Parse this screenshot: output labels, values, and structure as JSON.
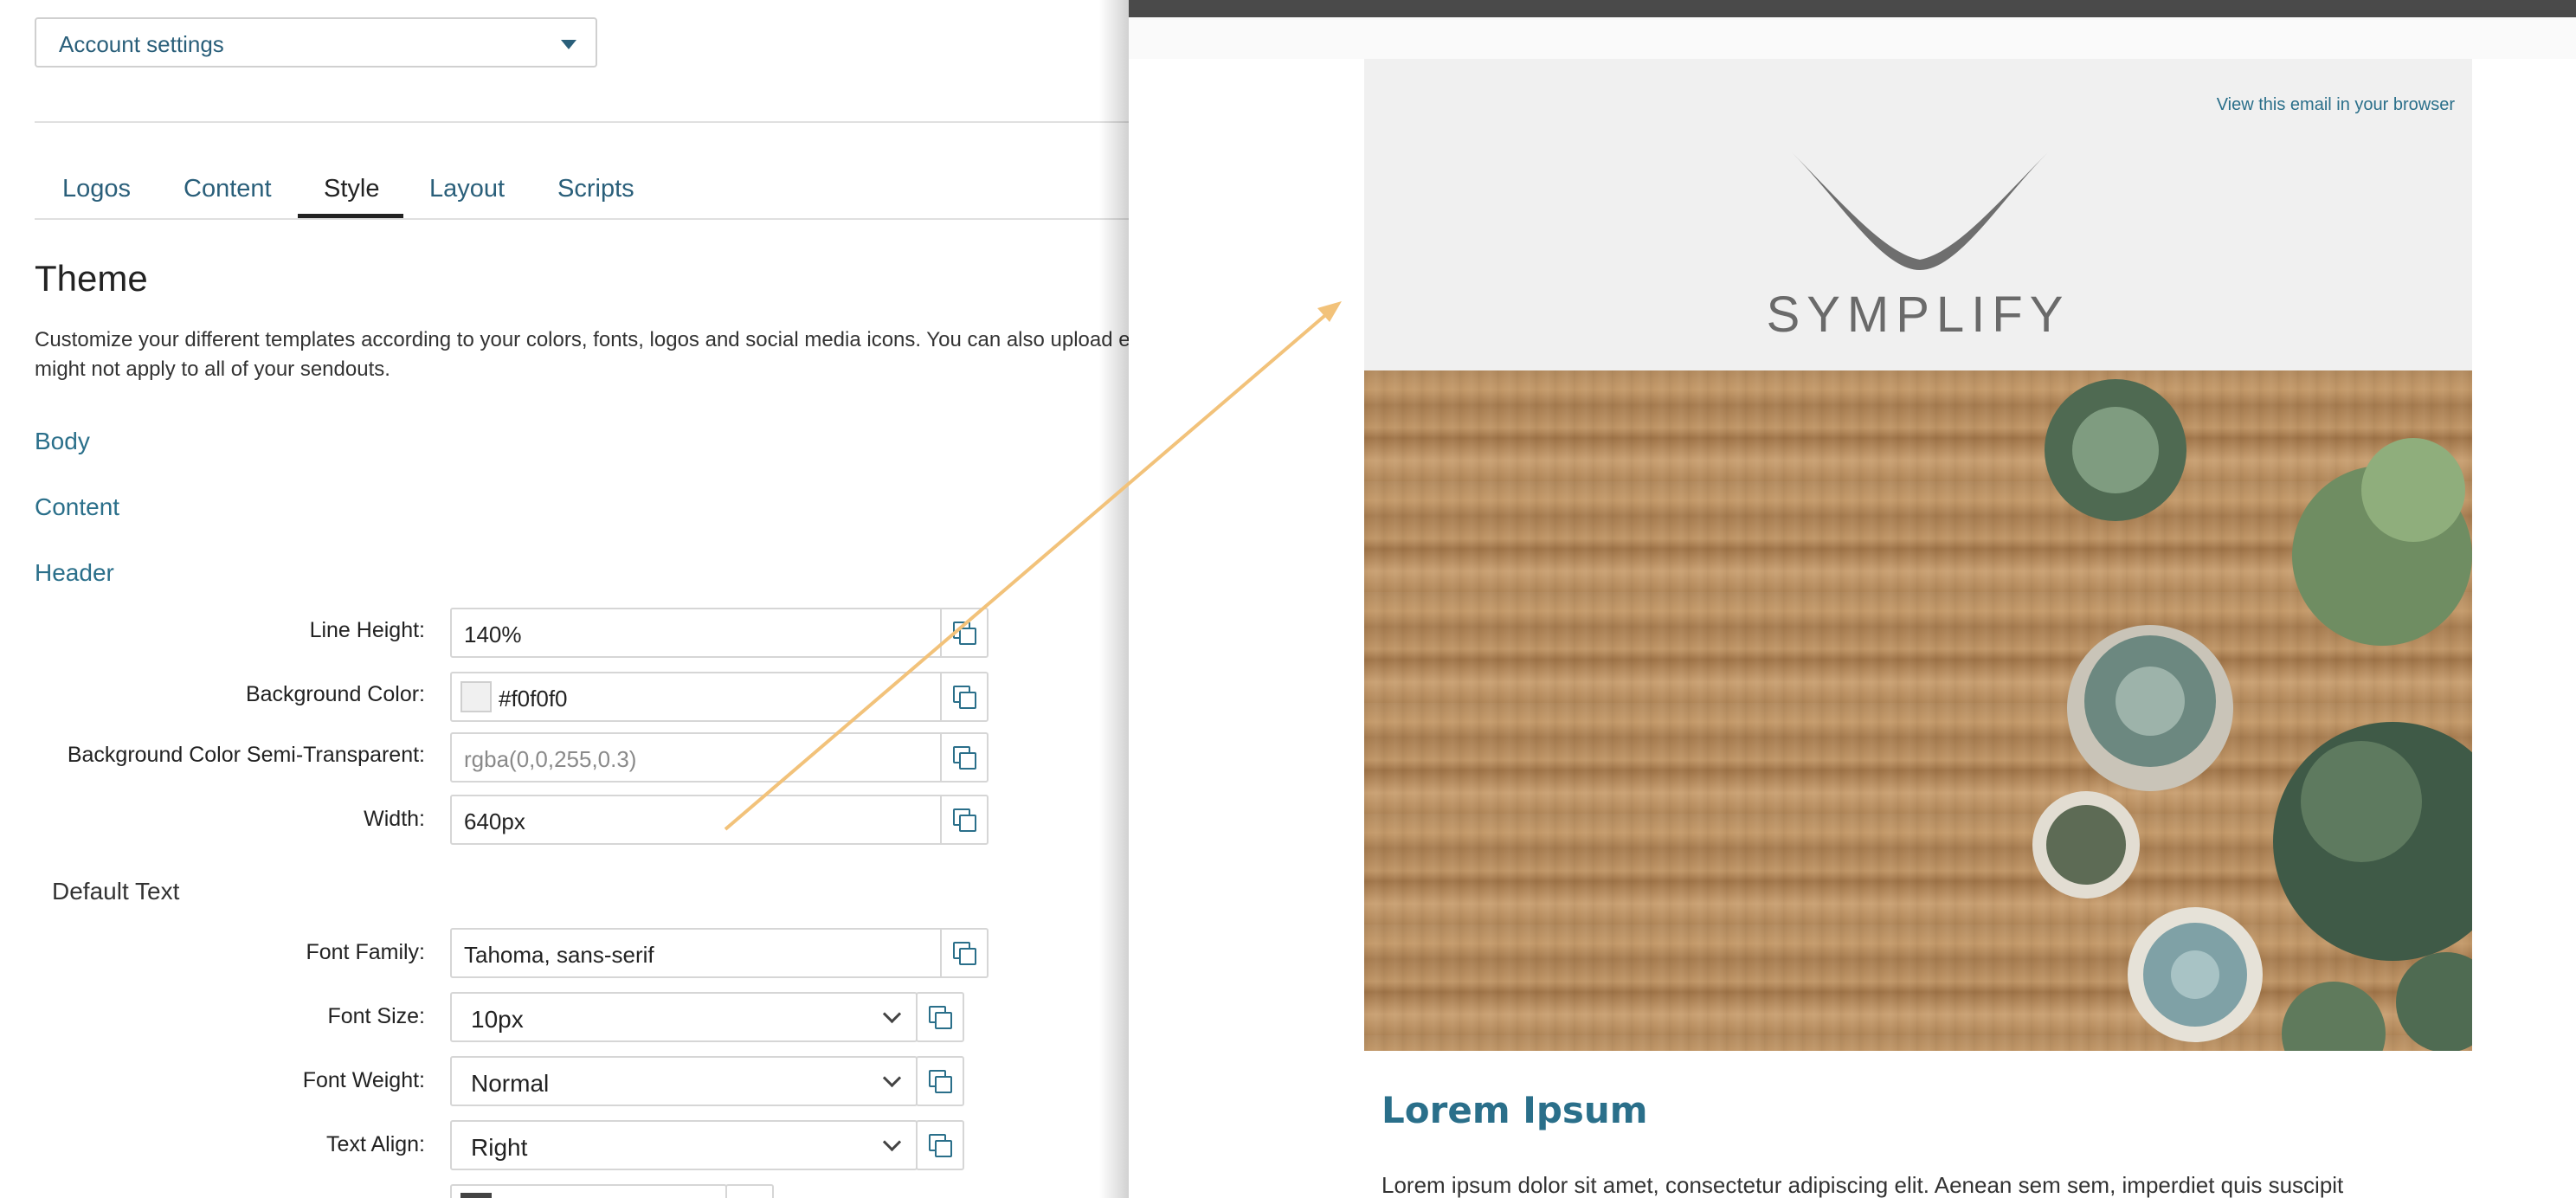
{
  "account_dropdown": {
    "label": "Account settings"
  },
  "tabs": [
    {
      "label": "Logos"
    },
    {
      "label": "Content"
    },
    {
      "label": "Style"
    },
    {
      "label": "Layout"
    },
    {
      "label": "Scripts"
    }
  ],
  "active_tab": "Style",
  "theme": {
    "title": "Theme",
    "description": "Customize your different templates according to your colors, fonts, logos and social media icons. You can also upload e might not apply to all of your sendouts."
  },
  "sections": {
    "body": "Body",
    "content": "Content",
    "header": "Header"
  },
  "header_fields": {
    "line_height": {
      "label": "Line Height:",
      "value": "140%"
    },
    "background_color": {
      "label": "Background Color:",
      "value": "#f0f0f0",
      "swatch": "#f0f0f0"
    },
    "background_semi": {
      "label": "Background Color Semi-Transparent:",
      "placeholder": "rgba(0,0,255,0.3)"
    },
    "width": {
      "label": "Width:",
      "value": "640px"
    }
  },
  "default_text": {
    "title": "Default Text",
    "font_family": {
      "label": "Font Family:",
      "value": "Tahoma, sans-serif"
    },
    "font_size": {
      "label": "Font Size:",
      "value": "10px"
    },
    "font_weight": {
      "label": "Font Weight:",
      "value": "Normal"
    },
    "text_align": {
      "label": "Text Align:",
      "value": "Right"
    }
  },
  "preview": {
    "view_link": "View this email in your browser",
    "logo_text": "SYMPLIFY",
    "heading": "Lorem Ipsum",
    "body": "Lorem ipsum dolor sit amet, consectetur adipiscing elit. Aenean sem sem, imperdiet quis suscipit"
  },
  "colors": {
    "accent": "#2a6f8a",
    "arrow": "#f2c27a",
    "header_bg": "#f0f0f0"
  }
}
